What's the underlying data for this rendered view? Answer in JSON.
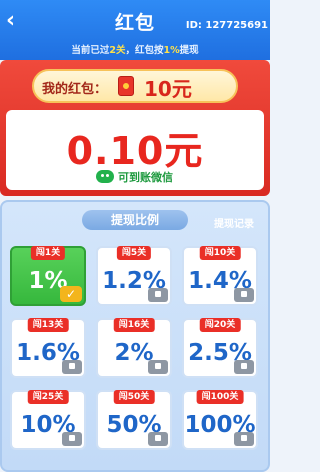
{
  "header": {
    "back_icon": "‹",
    "title": "红包",
    "user_id": "ID: 127725691",
    "notice_prefix": "当前已过",
    "notice_level": "2关",
    "notice_mid": "，红包按",
    "notice_ratio": "1%",
    "notice_suffix": "提现"
  },
  "wallet": {
    "label": "我的红包：",
    "value": "10元",
    "withdraw_amount": "0.10元",
    "withdraw_note": "可到账微信"
  },
  "ratio": {
    "title": "提现比例",
    "record_link": "提现记录",
    "tiles": [
      {
        "tag": "闯1关",
        "value": "1%",
        "state": "active"
      },
      {
        "tag": "闯5关",
        "value": "1.2%",
        "state": "locked"
      },
      {
        "tag": "闯10关",
        "value": "1.4%",
        "state": "locked"
      },
      {
        "tag": "闯13关",
        "value": "1.6%",
        "state": "locked"
      },
      {
        "tag": "闯16关",
        "value": "2%",
        "state": "locked"
      },
      {
        "tag": "闯20关",
        "value": "2.5%",
        "state": "locked"
      },
      {
        "tag": "闯25关",
        "value": "10%",
        "state": "locked"
      },
      {
        "tag": "闯50关",
        "value": "50%",
        "state": "locked"
      },
      {
        "tag": "闯100关",
        "value": "100%",
        "state": "locked"
      }
    ]
  },
  "colors": {
    "accent_blue": "#1f6fe0",
    "red": "#e8271f",
    "green": "#36b83d"
  }
}
